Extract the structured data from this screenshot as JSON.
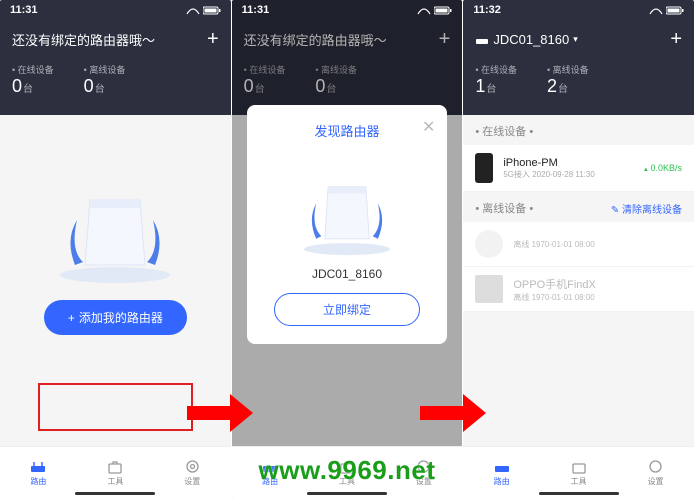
{
  "status": {
    "time_a": "11:31",
    "time_b": "11:31",
    "time_c": "11:32"
  },
  "screen1": {
    "title": "还没有绑定的路由器哦～",
    "stat1_label": "在线设备",
    "stat1_value": "0",
    "stat1_unit": "台",
    "stat2_label": "离线设备",
    "stat2_value": "0",
    "stat2_unit": "台",
    "add_btn": "添加我的路由器"
  },
  "tabs": {
    "router": "路由",
    "tools": "工具",
    "settings": "设置"
  },
  "screen2": {
    "title": "还没有绑定的路由器哦～",
    "stat1_label": "在线设备",
    "stat1_value": "0",
    "stat1_unit": "台",
    "stat2_label": "离线设备",
    "stat2_value": "0",
    "stat2_unit": "台",
    "modal_title": "发现路由器",
    "device_name": "JDC01_8160",
    "bind_btn": "立即绑定"
  },
  "screen3": {
    "title": "JDC01_8160",
    "stat1_label": "在线设备",
    "stat1_value": "1",
    "stat1_unit": "台",
    "stat2_label": "离线设备",
    "stat2_value": "2",
    "stat2_unit": "台",
    "online_section": "在线设备",
    "offline_section": "离线设备",
    "clear_offline": "清除离线设备",
    "dev1_name": "iPhone-PM",
    "dev1_sub": "5G接入 2020-09-28 11:30",
    "dev1_rate": "0.0KB/s",
    "dev2_name": " ",
    "dev2_sub": "离线 1970-01-01 08:00",
    "dev3_name": "OPPO手机FindX",
    "dev3_sub": "离线 1970-01-01 08:00"
  },
  "watermark": "www.9969.net"
}
